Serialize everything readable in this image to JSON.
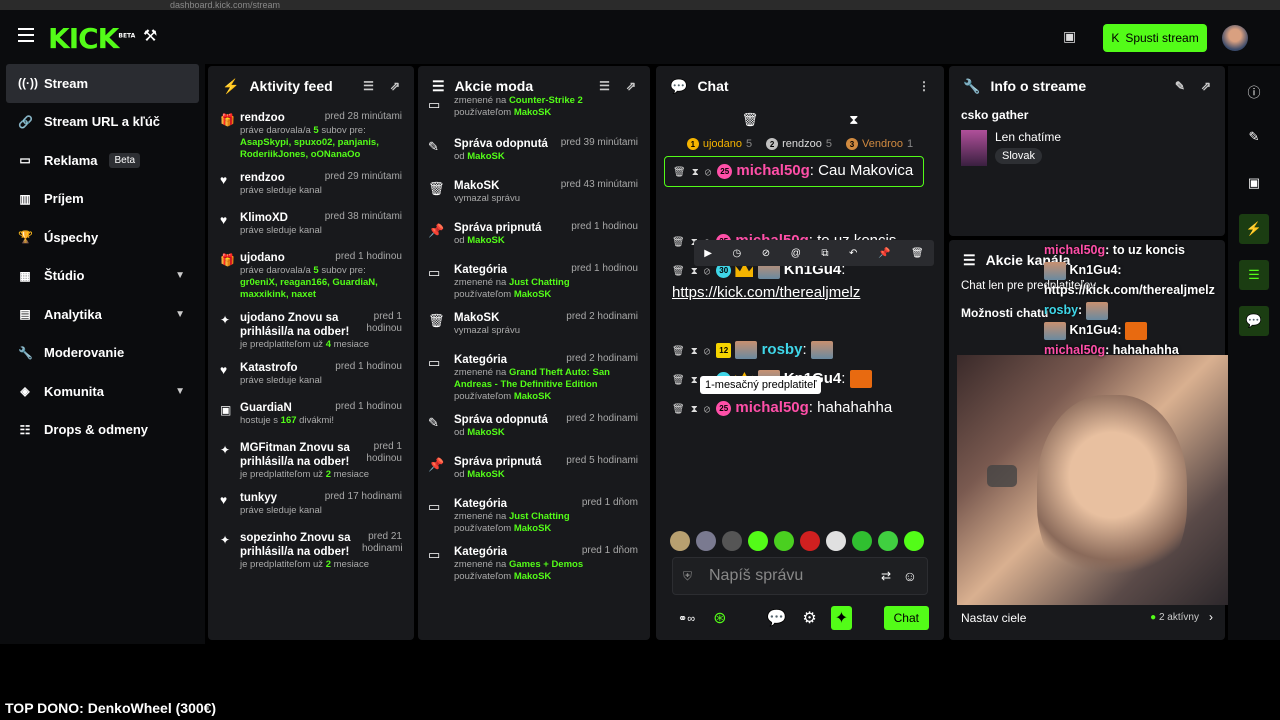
{
  "browser": {
    "url": "dashboard.kick.com/stream",
    "zoom": "120 %"
  },
  "header": {
    "logo": "KICK",
    "logo_beta": "BETA",
    "go_live_label": "Spusti stream"
  },
  "sidebar": {
    "items": [
      {
        "label": "Stream",
        "icon": "broadcast-icon"
      },
      {
        "label": "Stream URL a kľúč",
        "icon": "link-icon"
      },
      {
        "label": "Reklama",
        "badge": "Beta",
        "icon": "ad-icon"
      },
      {
        "label": "Príjem",
        "icon": "chart-icon"
      },
      {
        "label": "Úspechy",
        "icon": "trophy-icon"
      },
      {
        "label": "Štúdio",
        "icon": "studio-icon"
      },
      {
        "label": "Analytika",
        "icon": "analytics-icon"
      },
      {
        "label": "Moderovanie",
        "icon": "wrench-icon"
      },
      {
        "label": "Komunita",
        "icon": "community-icon"
      },
      {
        "label": "Drops & odmeny",
        "icon": "drops-icon"
      }
    ]
  },
  "activity": {
    "title": "Aktivity feed",
    "items": [
      {
        "name": "rendzoo",
        "time": "pred 28 minútami",
        "l1": "práve darovala/a ",
        "n": "5",
        "l2": " subov pre:",
        "l3": "AsapSkypi, spuxo02, panjanis, RoderiikJones, oONanaOo"
      },
      {
        "name": "rendzoo",
        "time": "pred 29 minútami",
        "l1": "práve sleduje kanal"
      },
      {
        "name": "KlimoXD",
        "time": "pred 38 minútami",
        "l1": "práve sleduje kanal"
      },
      {
        "name": "ujodano",
        "time": "pred 1 hodinou",
        "l1": "práve darovala/a ",
        "n": "5",
        "l2": " subov pre:",
        "l3": "gr0eniX, reagan166, GuardiaN, maxxikink, naxet"
      },
      {
        "name": "ujodano Znovu sa prihlásil/a na odber!",
        "time": "pred 1 hodinou",
        "l1": "je predplatiteľom už ",
        "n": "4",
        "l2": " mesiace"
      },
      {
        "name": "Katastrofo",
        "time": "pred 1 hodinou",
        "l1": "práve sleduje kanal"
      },
      {
        "name": "GuardiaN",
        "time": "pred 1 hodinou",
        "l1": "hostuje s ",
        "n": "167",
        "l2": " divákmi!"
      },
      {
        "name": "MGFitman Znovu sa prihlásil/a na odber!",
        "time": "pred 1 hodinou",
        "l1": "je predplatiteľom už ",
        "n": "2",
        "l2": " mesiace"
      },
      {
        "name": "tunkyy",
        "time": "pred 17 hodinami",
        "l1": "práve sleduje kanal"
      },
      {
        "name": "sopezinho Znovu sa prihlásil/a na odber!",
        "time": "pred 21 hodinami",
        "l1": "je predplatiteľom už ",
        "n": "2",
        "l2": " mesiace"
      }
    ]
  },
  "mod": {
    "title": "Akcie moda",
    "items": [
      {
        "title": "",
        "time": "",
        "s1": "zmenené na ",
        "g": "Counter-Strike 2",
        "s2": "používateľom ",
        "u": "MakoSK"
      },
      {
        "title": "Správa odopnutá",
        "time": "pred 39 minútami",
        "s1": "",
        "s2": "od ",
        "u": "MakoSK"
      },
      {
        "title": "MakoSK",
        "time": "pred 43 minútami",
        "s1": "vymazal správu"
      },
      {
        "title": "Správa pripnutá",
        "time": "pred 1 hodinou",
        "s2": "od ",
        "u": "MakoSK"
      },
      {
        "title": "Kategória",
        "time": "pred 1 hodinou",
        "s1": "zmenené na ",
        "g": "Just Chatting",
        "s2": "používateľom ",
        "u": "MakoSK"
      },
      {
        "title": "MakoSK",
        "time": "pred 2 hodinami",
        "s1": "vymazal správu"
      },
      {
        "title": "Kategória",
        "time": "pred 2 hodinami",
        "s1": "zmenené na ",
        "g": "Grand Theft Auto: San Andreas - The Definitive Edition",
        "s2": "používateľom ",
        "u": "MakoSK"
      },
      {
        "title": "Správa odopnutá",
        "time": "pred 2 hodinami",
        "s2": "od ",
        "u": "MakoSK"
      },
      {
        "title": "Správa pripnutá",
        "time": "pred 5 hodinami",
        "s2": "od ",
        "u": "MakoSK"
      },
      {
        "title": "Kategória",
        "time": "pred 1 dňom",
        "s1": "zmenené na ",
        "g": "Just Chatting",
        "s2": "používateľom ",
        "u": "MakoSK"
      },
      {
        "title": "Kategória",
        "time": "pred 1 dňom",
        "s1": "zmenené na ",
        "g": "Games + Demos",
        "s2": "používateľom ",
        "u": "MakoSK"
      }
    ]
  },
  "chat": {
    "title": "Chat",
    "leaders": [
      {
        "rank": "1",
        "name": "ujodano",
        "count": "5",
        "color": "#f5b400"
      },
      {
        "rank": "2",
        "name": "rendzoo",
        "count": "5",
        "color": "#c0c0c0"
      },
      {
        "rank": "3",
        "name": "Vendroo",
        "count": "1",
        "color": "#d08a40"
      }
    ],
    "messages": [
      {
        "sub": "25",
        "user": "michal50g",
        "text": "Cau Makovica"
      },
      {
        "sub": "25",
        "user": "michal50g",
        "text": "to uz koncis"
      },
      {
        "sub": "30",
        "user": "Kn1Gu4",
        "text": "https://kick.com/therealjmelz"
      },
      {
        "sub": "12",
        "user": "rosby",
        "text": ""
      },
      {
        "sub": "30",
        "user": "Kn1Gu4",
        "text": ""
      },
      {
        "sub": "25",
        "user": "michal50g",
        "text": "hahahahha"
      }
    ],
    "tooltip": "1-mesačný predplatiteľ",
    "input_placeholder": "Napíš správu",
    "send_label": "Chat"
  },
  "info": {
    "title": "Info o streame",
    "stream_title": "csko gather",
    "category": "Len chatíme",
    "language": "Slovak"
  },
  "chat_actions": {
    "title": "Akcie kanála",
    "follower_only": "Chat len pre predplatiteľov",
    "options": "Možnosti chatu",
    "goals": "Nastav ciele",
    "active": "2 aktívny"
  },
  "overlay": {
    "lines": [
      {
        "user": "michal50g",
        "text": "to uz koncis"
      },
      {
        "user": "Kn1Gu4",
        "text": ""
      },
      {
        "user": "",
        "text": "https://kick.com/therealjmelz"
      },
      {
        "user": "rosby",
        "text": ""
      },
      {
        "user": "Kn1Gu4",
        "text": ""
      },
      {
        "user": "michal50g",
        "text": "hahahahha"
      }
    ]
  },
  "footer": {
    "top_dono": "TOP DONO: DenkoWheel (300€)"
  },
  "colors": {
    "accent": "#53fc18",
    "panel": "#18191c",
    "username": "#ff4fa8"
  }
}
